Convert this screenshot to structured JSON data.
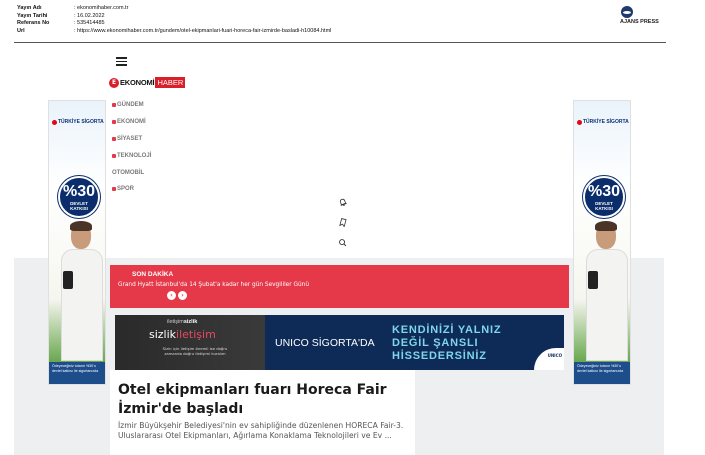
{
  "clipping": {
    "rows": [
      {
        "key": "Yayın Adı",
        "value": ": ekonomihaber.com.tr"
      },
      {
        "key": "Yayın Tarihi",
        "value": ": 16.02.2022"
      },
      {
        "key": "Referans No",
        "value": ": 535414485"
      },
      {
        "key": "Url",
        "value": ": https://www.ekonomihaber.com.tr/gundem/otel-ekipmanlari-fuari-horeca-fair-izmirde-basladi-h10084.html"
      }
    ],
    "agency": "AJANS PRESS"
  },
  "site": {
    "logo_mark": "E",
    "logo_part1": "EKONOMİ",
    "logo_part2": "HABER",
    "nav": [
      {
        "label": "GÜNDEM",
        "icon": "arrow-right-icon",
        "color": "#e5394a"
      },
      {
        "label": "EKONOMİ",
        "icon": "chart-icon",
        "color": "#e5394a"
      },
      {
        "label": "SİYASET",
        "icon": "flag-icon",
        "color": "#e5394a"
      },
      {
        "label": "TEKNOLOJİ",
        "icon": "chip-icon",
        "color": "#e5394a"
      },
      {
        "label": "OTOMOBİL",
        "icon": "",
        "color": ""
      },
      {
        "label": "SPOR",
        "icon": "trophy-icon",
        "color": "#e5394a"
      }
    ]
  },
  "breaking": {
    "title": "SON DAKİKA",
    "text": "Grand Hyatt İstanbul'da 14 Şubat'a kadar her gün Sevgililer Günü",
    "prev": "‹",
    "next": "›"
  },
  "side_ad": {
    "brand": "TÜRKİYE SİGORTA",
    "sub": "TÜRKİYE SİGORTA",
    "pct": "%30",
    "line1": "DEVLET",
    "line2": "KATKISI",
    "foot": "Ödeyeceğiniz tutarın %30'u devlet katkısı ile sigortanızda"
  },
  "banner": {
    "brand_pre": "iletişim",
    "brand_main": "sizlik",
    "title_a": "sizlik",
    "title_b": "iletişim",
    "desc": "Sizin için iletişim önemli ise doğru zamanda doğru iletişimi kuralım",
    "mid": "UNICO SİGORTA'DA",
    "right1": "KENDİNİZİ YALNIZ",
    "right2": "DEĞİL ŞANSLI",
    "right3": "HİSSEDERSİNİZ",
    "corner": "UNICO"
  },
  "article": {
    "title": "Otel ekipmanları fuarı Horeca Fair İzmir'de başladı",
    "summary": "İzmir Büyükşehir Belediyesi'nin ev sahipliğinde düzenlenen HORECA Fair-3. Uluslararası Otel Ekipmanları, Ağırlama Konaklama Teknolojileri ve Ev ..."
  }
}
